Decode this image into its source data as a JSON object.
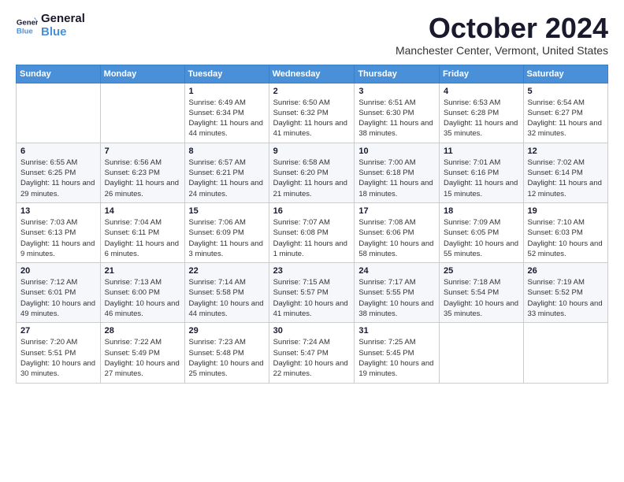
{
  "logo": {
    "line1": "General",
    "line2": "Blue"
  },
  "title": "October 2024",
  "subtitle": "Manchester Center, Vermont, United States",
  "days_of_week": [
    "Sunday",
    "Monday",
    "Tuesday",
    "Wednesday",
    "Thursday",
    "Friday",
    "Saturday"
  ],
  "weeks": [
    [
      {
        "day": "",
        "sunrise": "",
        "sunset": "",
        "daylight": ""
      },
      {
        "day": "",
        "sunrise": "",
        "sunset": "",
        "daylight": ""
      },
      {
        "day": "1",
        "sunrise": "Sunrise: 6:49 AM",
        "sunset": "Sunset: 6:34 PM",
        "daylight": "Daylight: 11 hours and 44 minutes."
      },
      {
        "day": "2",
        "sunrise": "Sunrise: 6:50 AM",
        "sunset": "Sunset: 6:32 PM",
        "daylight": "Daylight: 11 hours and 41 minutes."
      },
      {
        "day": "3",
        "sunrise": "Sunrise: 6:51 AM",
        "sunset": "Sunset: 6:30 PM",
        "daylight": "Daylight: 11 hours and 38 minutes."
      },
      {
        "day": "4",
        "sunrise": "Sunrise: 6:53 AM",
        "sunset": "Sunset: 6:28 PM",
        "daylight": "Daylight: 11 hours and 35 minutes."
      },
      {
        "day": "5",
        "sunrise": "Sunrise: 6:54 AM",
        "sunset": "Sunset: 6:27 PM",
        "daylight": "Daylight: 11 hours and 32 minutes."
      }
    ],
    [
      {
        "day": "6",
        "sunrise": "Sunrise: 6:55 AM",
        "sunset": "Sunset: 6:25 PM",
        "daylight": "Daylight: 11 hours and 29 minutes."
      },
      {
        "day": "7",
        "sunrise": "Sunrise: 6:56 AM",
        "sunset": "Sunset: 6:23 PM",
        "daylight": "Daylight: 11 hours and 26 minutes."
      },
      {
        "day": "8",
        "sunrise": "Sunrise: 6:57 AM",
        "sunset": "Sunset: 6:21 PM",
        "daylight": "Daylight: 11 hours and 24 minutes."
      },
      {
        "day": "9",
        "sunrise": "Sunrise: 6:58 AM",
        "sunset": "Sunset: 6:20 PM",
        "daylight": "Daylight: 11 hours and 21 minutes."
      },
      {
        "day": "10",
        "sunrise": "Sunrise: 7:00 AM",
        "sunset": "Sunset: 6:18 PM",
        "daylight": "Daylight: 11 hours and 18 minutes."
      },
      {
        "day": "11",
        "sunrise": "Sunrise: 7:01 AM",
        "sunset": "Sunset: 6:16 PM",
        "daylight": "Daylight: 11 hours and 15 minutes."
      },
      {
        "day": "12",
        "sunrise": "Sunrise: 7:02 AM",
        "sunset": "Sunset: 6:14 PM",
        "daylight": "Daylight: 11 hours and 12 minutes."
      }
    ],
    [
      {
        "day": "13",
        "sunrise": "Sunrise: 7:03 AM",
        "sunset": "Sunset: 6:13 PM",
        "daylight": "Daylight: 11 hours and 9 minutes."
      },
      {
        "day": "14",
        "sunrise": "Sunrise: 7:04 AM",
        "sunset": "Sunset: 6:11 PM",
        "daylight": "Daylight: 11 hours and 6 minutes."
      },
      {
        "day": "15",
        "sunrise": "Sunrise: 7:06 AM",
        "sunset": "Sunset: 6:09 PM",
        "daylight": "Daylight: 11 hours and 3 minutes."
      },
      {
        "day": "16",
        "sunrise": "Sunrise: 7:07 AM",
        "sunset": "Sunset: 6:08 PM",
        "daylight": "Daylight: 11 hours and 1 minute."
      },
      {
        "day": "17",
        "sunrise": "Sunrise: 7:08 AM",
        "sunset": "Sunset: 6:06 PM",
        "daylight": "Daylight: 10 hours and 58 minutes."
      },
      {
        "day": "18",
        "sunrise": "Sunrise: 7:09 AM",
        "sunset": "Sunset: 6:05 PM",
        "daylight": "Daylight: 10 hours and 55 minutes."
      },
      {
        "day": "19",
        "sunrise": "Sunrise: 7:10 AM",
        "sunset": "Sunset: 6:03 PM",
        "daylight": "Daylight: 10 hours and 52 minutes."
      }
    ],
    [
      {
        "day": "20",
        "sunrise": "Sunrise: 7:12 AM",
        "sunset": "Sunset: 6:01 PM",
        "daylight": "Daylight: 10 hours and 49 minutes."
      },
      {
        "day": "21",
        "sunrise": "Sunrise: 7:13 AM",
        "sunset": "Sunset: 6:00 PM",
        "daylight": "Daylight: 10 hours and 46 minutes."
      },
      {
        "day": "22",
        "sunrise": "Sunrise: 7:14 AM",
        "sunset": "Sunset: 5:58 PM",
        "daylight": "Daylight: 10 hours and 44 minutes."
      },
      {
        "day": "23",
        "sunrise": "Sunrise: 7:15 AM",
        "sunset": "Sunset: 5:57 PM",
        "daylight": "Daylight: 10 hours and 41 minutes."
      },
      {
        "day": "24",
        "sunrise": "Sunrise: 7:17 AM",
        "sunset": "Sunset: 5:55 PM",
        "daylight": "Daylight: 10 hours and 38 minutes."
      },
      {
        "day": "25",
        "sunrise": "Sunrise: 7:18 AM",
        "sunset": "Sunset: 5:54 PM",
        "daylight": "Daylight: 10 hours and 35 minutes."
      },
      {
        "day": "26",
        "sunrise": "Sunrise: 7:19 AM",
        "sunset": "Sunset: 5:52 PM",
        "daylight": "Daylight: 10 hours and 33 minutes."
      }
    ],
    [
      {
        "day": "27",
        "sunrise": "Sunrise: 7:20 AM",
        "sunset": "Sunset: 5:51 PM",
        "daylight": "Daylight: 10 hours and 30 minutes."
      },
      {
        "day": "28",
        "sunrise": "Sunrise: 7:22 AM",
        "sunset": "Sunset: 5:49 PM",
        "daylight": "Daylight: 10 hours and 27 minutes."
      },
      {
        "day": "29",
        "sunrise": "Sunrise: 7:23 AM",
        "sunset": "Sunset: 5:48 PM",
        "daylight": "Daylight: 10 hours and 25 minutes."
      },
      {
        "day": "30",
        "sunrise": "Sunrise: 7:24 AM",
        "sunset": "Sunset: 5:47 PM",
        "daylight": "Daylight: 10 hours and 22 minutes."
      },
      {
        "day": "31",
        "sunrise": "Sunrise: 7:25 AM",
        "sunset": "Sunset: 5:45 PM",
        "daylight": "Daylight: 10 hours and 19 minutes."
      },
      {
        "day": "",
        "sunrise": "",
        "sunset": "",
        "daylight": ""
      },
      {
        "day": "",
        "sunrise": "",
        "sunset": "",
        "daylight": ""
      }
    ]
  ]
}
